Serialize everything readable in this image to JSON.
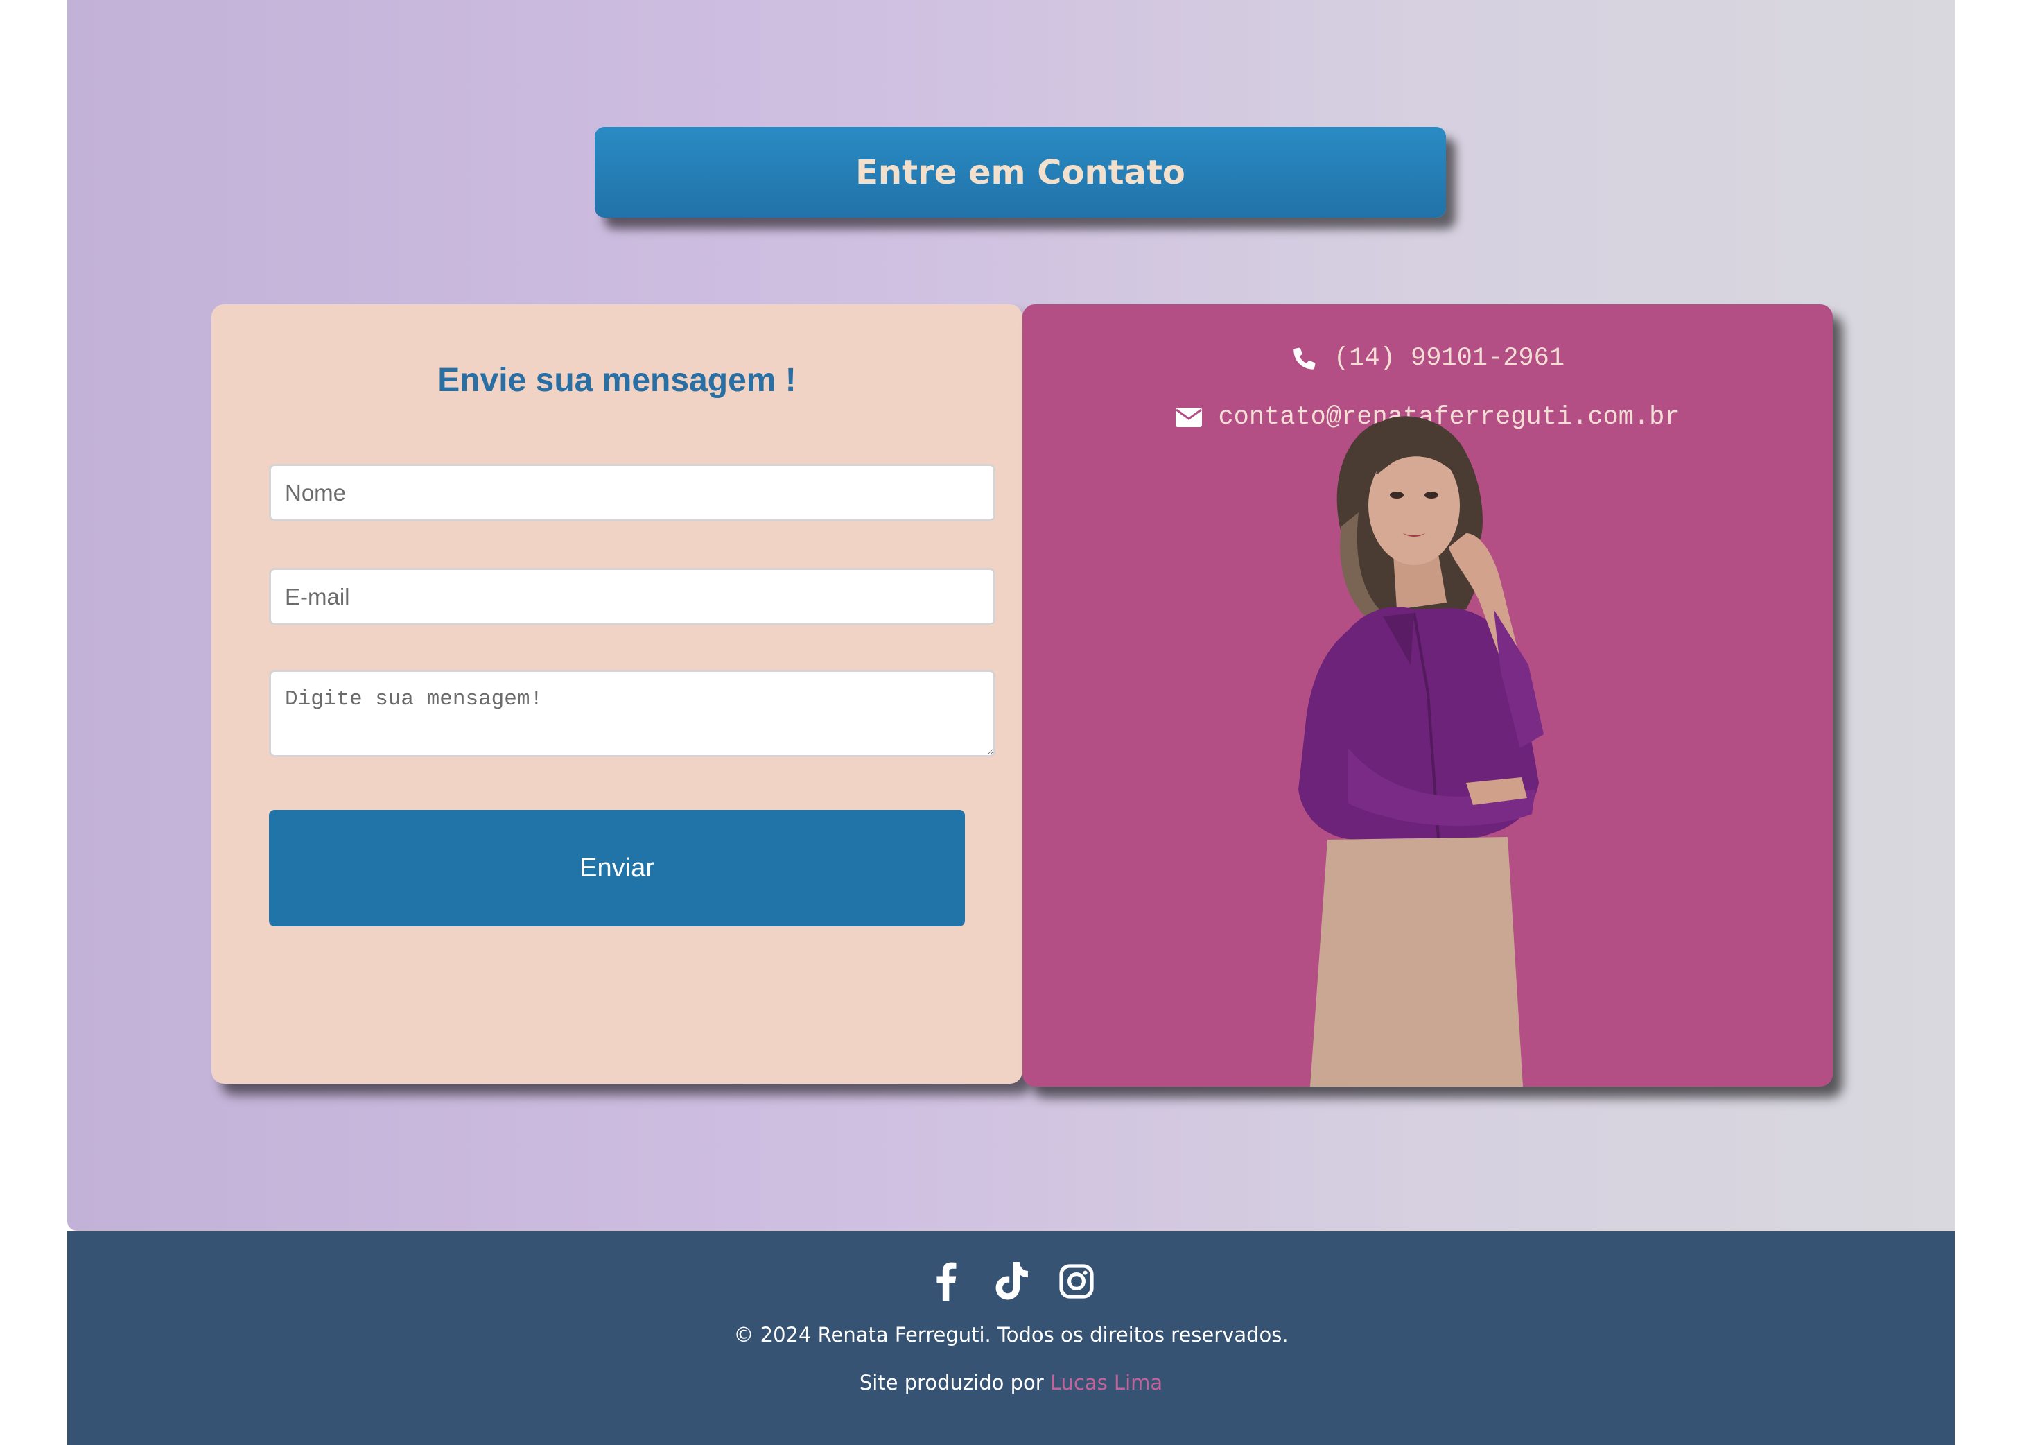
{
  "header": {
    "title": "Entre em Contato"
  },
  "form": {
    "title": "Envie sua mensagem !",
    "name_placeholder": "Nome",
    "email_placeholder": "E-mail",
    "message_placeholder": "Digite sua mensagem!",
    "submit_label": "Enviar"
  },
  "contact": {
    "phone": "(14) 99101-2961",
    "email": "contato@renataferreguti.com.br"
  },
  "footer": {
    "social_icons": [
      "facebook-icon",
      "tiktok-icon",
      "instagram-icon"
    ],
    "copyright": "© 2024 Renata Ferreguti. Todos os direitos reservados.",
    "credit_prefix": "Site produzido por ",
    "credit_name": "Lucas Lima"
  },
  "colors": {
    "primary_blue": "#2174a8",
    "form_bg": "#f0d3c5",
    "info_bg": "#b44f85",
    "footer_bg": "#375373",
    "credit_link": "#c2639b"
  }
}
